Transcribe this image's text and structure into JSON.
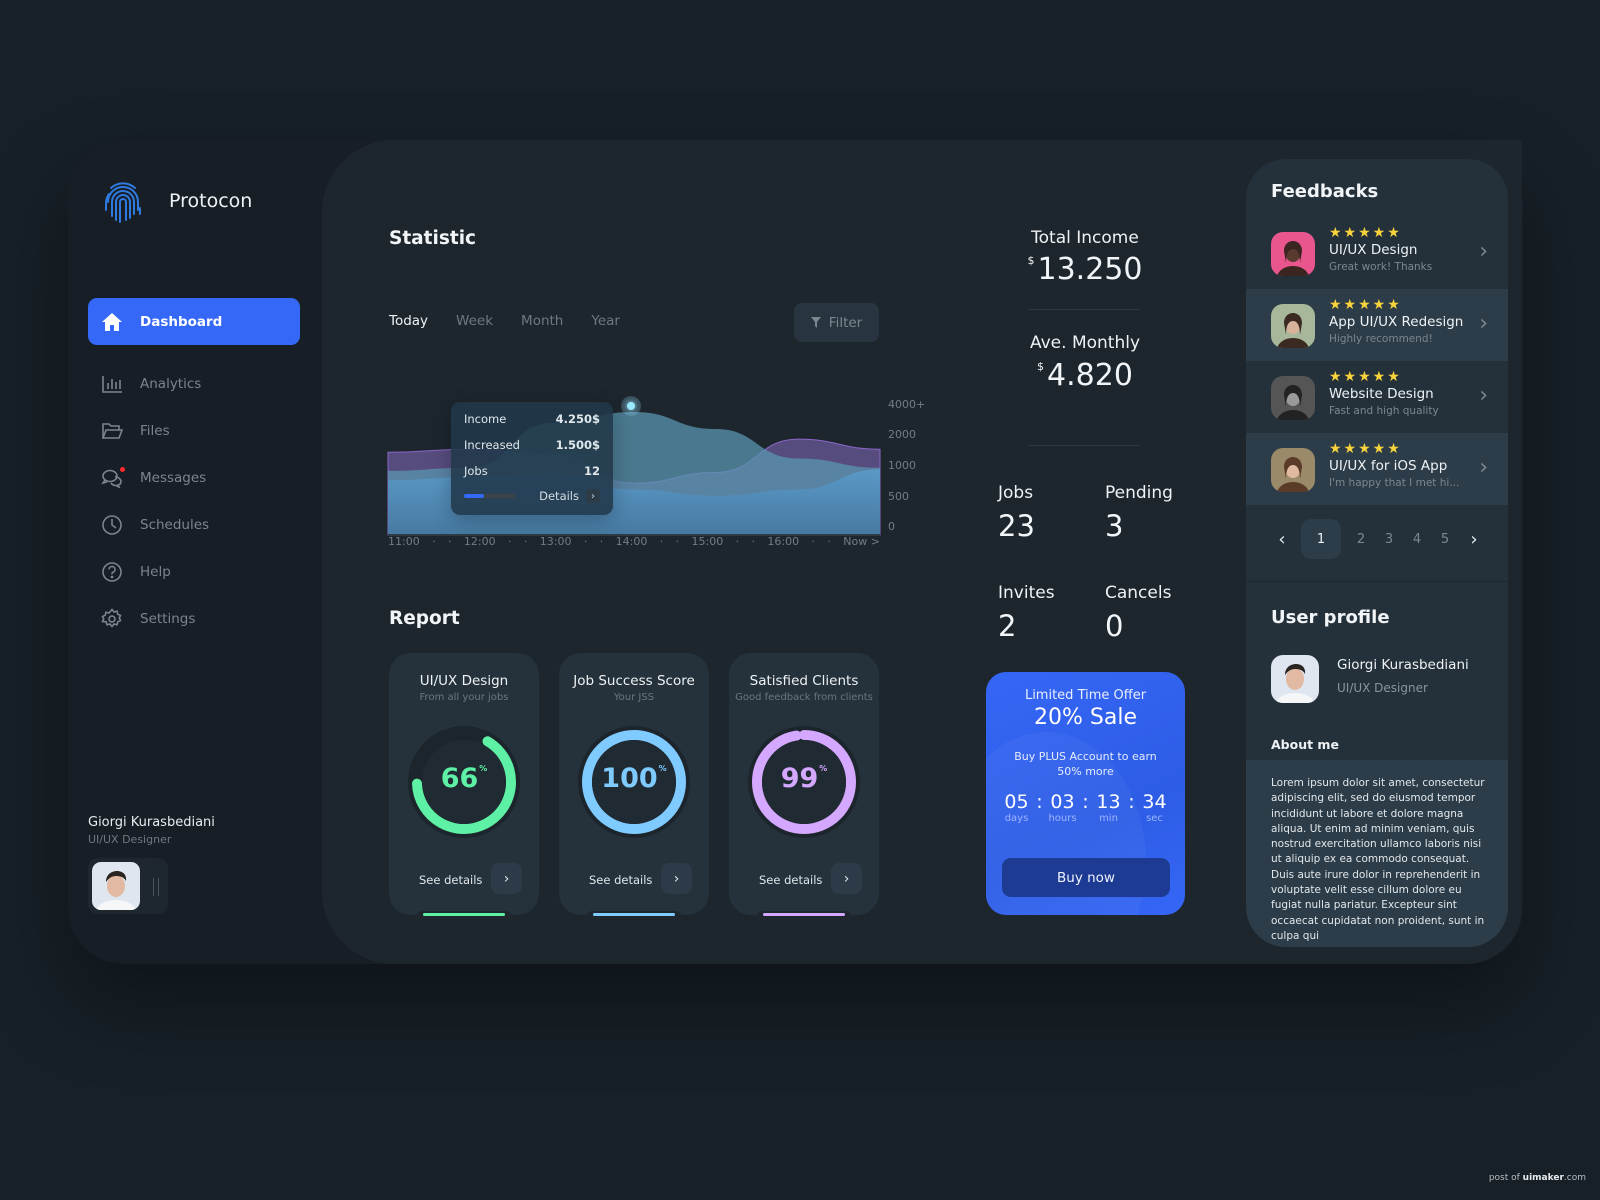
{
  "app": {
    "brand": "Protocon",
    "logo_icon": "fingerprint-icon"
  },
  "sidebar": {
    "items": [
      {
        "label": "Dashboard",
        "icon": "home-icon",
        "active": true
      },
      {
        "label": "Analytics",
        "icon": "bar-chart-icon"
      },
      {
        "label": "Files",
        "icon": "folder-open-icon"
      },
      {
        "label": "Messages",
        "icon": "chat-bubbles-icon",
        "notification": true
      },
      {
        "label": "Schedules",
        "icon": "clock-icon"
      },
      {
        "label": "Help",
        "icon": "help-circle-icon"
      },
      {
        "label": "Settings",
        "icon": "gear-icon"
      }
    ],
    "user": {
      "name": "Giorgi Kurasbediani",
      "role": "UI/UX Designer"
    }
  },
  "statistic": {
    "title": "Statistic",
    "tabs": [
      "Today",
      "Week",
      "Month",
      "Year"
    ],
    "active_tab": "Today",
    "filter_label": "Filter",
    "y_ticks": [
      "4000+",
      "2000",
      "1000",
      "500",
      "0"
    ],
    "x_ticks": [
      "11:00",
      "·",
      "·",
      "12:00",
      "·",
      "·",
      "13:00",
      "·",
      "·",
      "14:00",
      "·",
      "·",
      "15:00",
      "·",
      "·",
      "16:00",
      "·",
      "·",
      "Now >"
    ],
    "tooltip": {
      "rows": [
        {
          "label": "Income",
          "value": "4.250$"
        },
        {
          "label": "Increased",
          "value": "1.500$"
        },
        {
          "label": "Jobs",
          "value": "12"
        }
      ],
      "progress": 0.4,
      "details_label": "Details"
    }
  },
  "chart_data": {
    "type": "area",
    "title": "Statistic",
    "xlabel": "",
    "ylabel": "",
    "x": [
      "11:00",
      "12:00",
      "13:00",
      "14:00",
      "15:00",
      "16:00",
      "Now"
    ],
    "y_tick_labels": [
      "0",
      "500",
      "1000",
      "2000",
      "4000+"
    ],
    "series": [
      {
        "name": "purple",
        "color": "#6b5a9a",
        "values": [
          1700,
          1800,
          1600,
          850,
          1050,
          2250,
          1800
        ]
      },
      {
        "name": "teal",
        "color": "#5a95b0",
        "values": [
          1100,
          1200,
          3300,
          4000,
          2900,
          1500,
          1200
        ]
      },
      {
        "name": "blue",
        "color": "#4f89b6",
        "values": [
          900,
          950,
          1000,
          750,
          650,
          750,
          1150
        ]
      }
    ],
    "highlight": {
      "x": "14:00",
      "series": "teal"
    }
  },
  "report": {
    "title": "Report",
    "see_details": "See details",
    "cards": [
      {
        "title": "UI/UX Design",
        "subtitle": "From all your jobs",
        "value": 66,
        "display": "66",
        "color": "#5ef0a4"
      },
      {
        "title": "Job Success Score",
        "subtitle": "Your JSS",
        "value": 100,
        "display": "100",
        "color": "#7fcbff"
      },
      {
        "title": "Satisfied Clients",
        "subtitle": "Good feedback from clients",
        "value": 99,
        "display": "99",
        "color": "#d5a8ff"
      }
    ],
    "percent_sign": "%"
  },
  "totals": {
    "total_income": {
      "label": "Total Income",
      "currency": "$",
      "value": "13.250"
    },
    "avg_monthly": {
      "label": "Ave. Monthly",
      "currency": "$",
      "value": "4.820"
    },
    "stats": [
      {
        "label": "Jobs",
        "value": "23"
      },
      {
        "label": "Pending",
        "value": "3"
      },
      {
        "label": "Invites",
        "value": "2"
      },
      {
        "label": "Cancels",
        "value": "0"
      }
    ]
  },
  "offer": {
    "eyebrow": "Limited Time Offer",
    "headline": "20% Sale",
    "description": "Buy PLUS Account to earn 50% more",
    "countdown": [
      {
        "value": "05",
        "unit": "days"
      },
      {
        "value": "03",
        "unit": "hours"
      },
      {
        "value": "13",
        "unit": "min"
      },
      {
        "value": "34",
        "unit": "sec"
      }
    ],
    "button": "Buy now",
    "color": "#3566f6"
  },
  "feedbacks": {
    "title": "Feedbacks",
    "items": [
      {
        "stars": 5,
        "title": "UI/UX Design",
        "comment": "Great work! Thanks"
      },
      {
        "stars": 5,
        "title": "App UI/UX Redesign",
        "comment": "Highly recommend!"
      },
      {
        "stars": 5,
        "title": "Website Design",
        "comment": "Fast and high quality"
      },
      {
        "stars": 5,
        "title": "UI/UX for iOS App",
        "comment": "I'm happy that I met hi..."
      }
    ],
    "pages": [
      "1",
      "2",
      "3",
      "4",
      "5"
    ],
    "current_page": "1",
    "star_color": "#f9d33b"
  },
  "user_profile": {
    "title": "User profile",
    "name": "Giorgi Kurasbediani",
    "role": "UI/UX Designer",
    "about_title": "About me",
    "about": "Lorem ipsum dolor sit amet, consectetur adipiscing elit, sed do eiusmod tempor incididunt ut labore et dolore magna aliqua. Ut enim ad minim veniam, quis nostrud exercitation ullamco laboris nisi ut aliquip ex ea commodo consequat. Duis aute irure dolor in reprehenderit in voluptate velit esse cillum dolore eu fugiat nulla pariatur. Excepteur sint occaecat cupidatat non proident, sunt in culpa qui"
  },
  "credit": {
    "prefix": "post of ",
    "brand": "uimaker",
    "suffix": ".com"
  }
}
